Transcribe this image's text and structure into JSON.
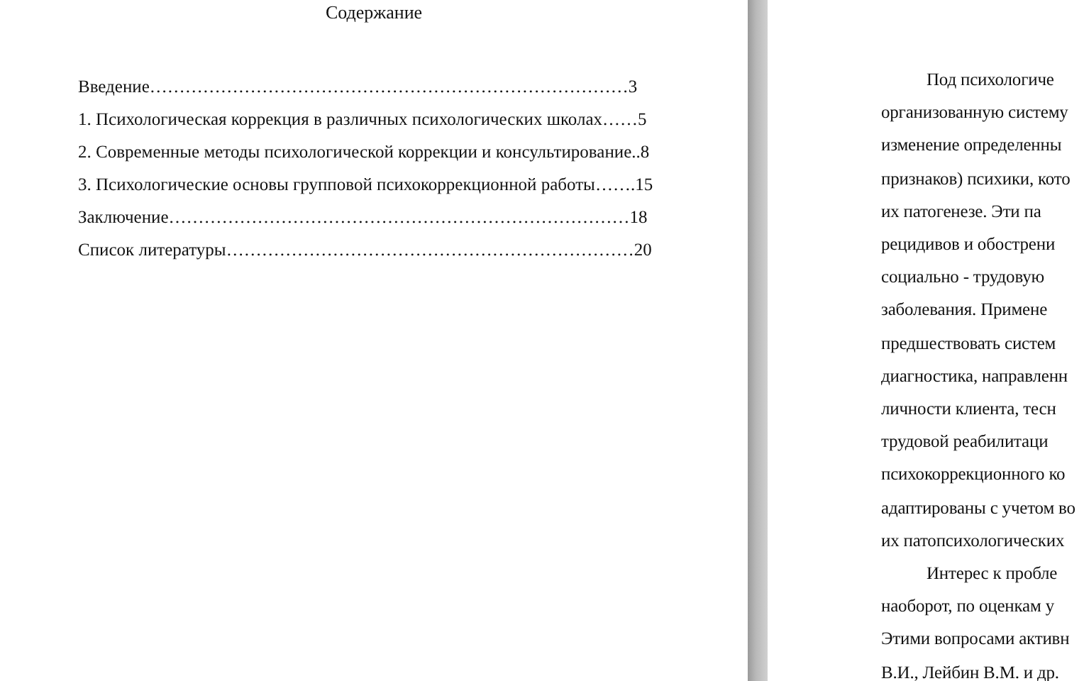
{
  "pages": [
    {
      "kind": "contents",
      "title": "Содержание",
      "entries": [
        {
          "text": "Введение………………………………………………………………………3"
        },
        {
          "text": "1. Психологическая коррекция в различных психологических школах……5"
        },
        {
          "text": "2. Современные методы психологической коррекции и консультирование..8"
        },
        {
          "text": "3. Психологические основы групповой психокоррекционной работы…….15"
        },
        {
          "text": "Заключение……………………………………………………………………18"
        },
        {
          "text": "Список литературы……………………………………………………………20"
        }
      ]
    },
    {
      "kind": "body",
      "lines": [
        {
          "text": "Под психологиче",
          "indent": true
        },
        {
          "text": "организованную систему",
          "indent": false
        },
        {
          "text": "изменение определенны",
          "indent": false
        },
        {
          "text": "признаков) психики, кото",
          "indent": false
        },
        {
          "text": "их патогенезе. Эти па",
          "indent": false
        },
        {
          "text": "рецидивов и обострени",
          "indent": false
        },
        {
          "text": "социально - трудовую",
          "indent": false
        },
        {
          "text": "заболевания. Примене",
          "indent": false
        },
        {
          "text": "предшествовать систем",
          "indent": false
        },
        {
          "text": "диагностика, направленн",
          "indent": false
        },
        {
          "text": "личности клиента, тесн",
          "indent": false
        },
        {
          "text": "трудовой реабилитаци",
          "indent": false
        },
        {
          "text": "психокоррекционного ко",
          "indent": false
        },
        {
          "text": "адаптированы с учетом во",
          "indent": false
        },
        {
          "text": "их патопсихологических",
          "indent": false
        },
        {
          "text": "Интерес к пробле",
          "indent": true
        },
        {
          "text": "наоборот, по оценкам у",
          "indent": false
        },
        {
          "text": "Этими вопросами активн",
          "indent": false
        },
        {
          "text": "В.И., Лейбин В.М. и др.",
          "indent": false
        }
      ]
    }
  ]
}
